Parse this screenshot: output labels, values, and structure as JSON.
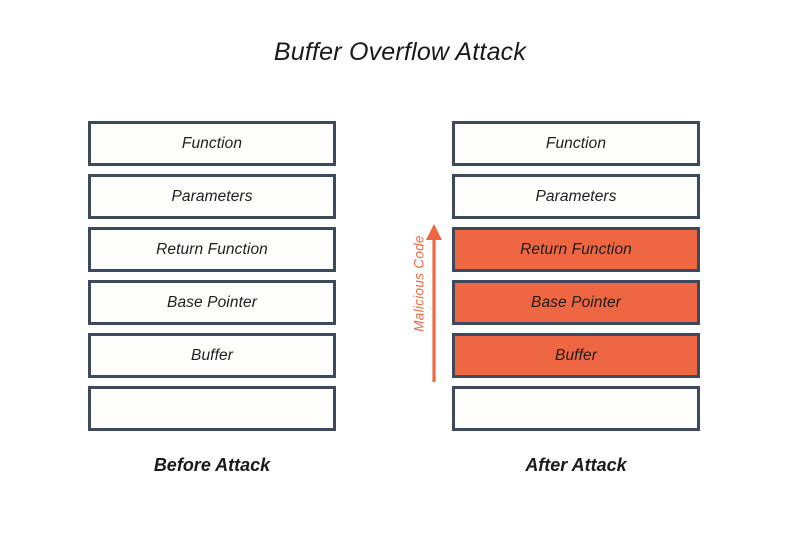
{
  "diagram": {
    "title": "Buffer Overflow Attack",
    "colors": {
      "border": "#3d4a5c",
      "box_fill": "#fdfdfc",
      "overflow_fill": "#ef6742",
      "accent": "#ef6742",
      "text": "#1a1a1a",
      "background": "#ffffff"
    },
    "columns": [
      {
        "id": "before",
        "caption": "Before Attack",
        "boxes": [
          {
            "label": "Function",
            "overflowed": false
          },
          {
            "label": "Parameters",
            "overflowed": false
          },
          {
            "label": "Return Function",
            "overflowed": false
          },
          {
            "label": "Base Pointer",
            "overflowed": false
          },
          {
            "label": "Buffer",
            "overflowed": false
          },
          {
            "label": "",
            "overflowed": false
          }
        ]
      },
      {
        "id": "after",
        "caption": "After Attack",
        "boxes": [
          {
            "label": "Function",
            "overflowed": false
          },
          {
            "label": "Parameters",
            "overflowed": false
          },
          {
            "label": "Return Function",
            "overflowed": true
          },
          {
            "label": "Base Pointer",
            "overflowed": true
          },
          {
            "label": "Buffer",
            "overflowed": true
          },
          {
            "label": "",
            "overflowed": false
          }
        ]
      }
    ],
    "annotation": {
      "label": "Malicious Code",
      "direction": "up",
      "icon": "arrow-up-icon"
    }
  }
}
